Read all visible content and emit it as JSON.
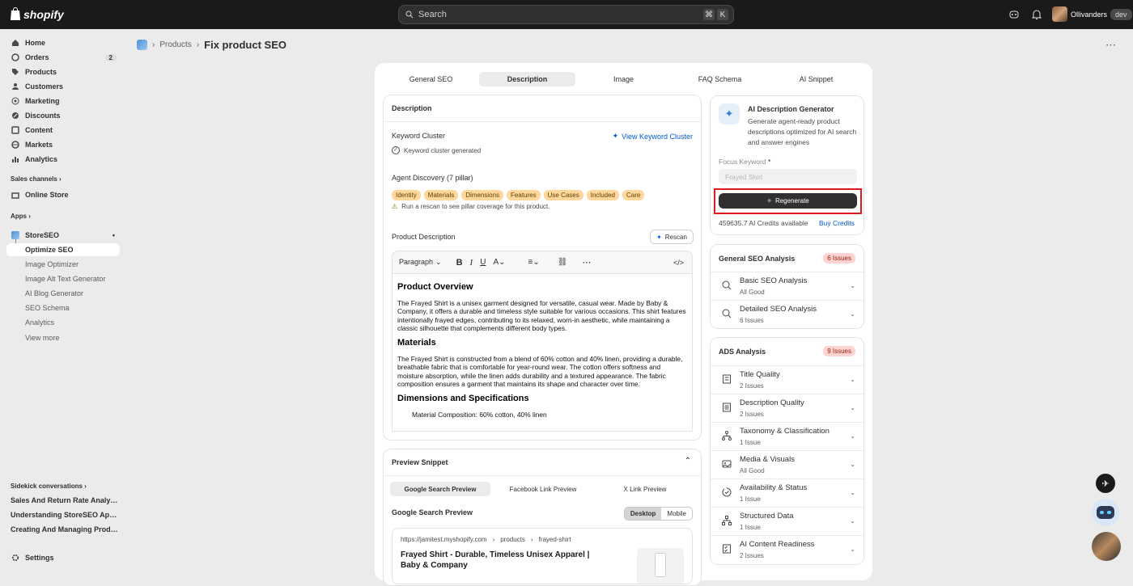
{
  "topbar": {
    "brand": "shopify",
    "search_placeholder": "Search",
    "kbd": [
      "⌘",
      "K"
    ],
    "store_name": "Ollivanders",
    "store_badge": "dev"
  },
  "sidebar": {
    "items": [
      {
        "label": "Home",
        "count": ""
      },
      {
        "label": "Orders",
        "count": "2"
      },
      {
        "label": "Products",
        "count": ""
      },
      {
        "label": "Customers",
        "count": ""
      },
      {
        "label": "Marketing",
        "count": ""
      },
      {
        "label": "Discounts",
        "count": ""
      },
      {
        "label": "Content",
        "count": ""
      },
      {
        "label": "Markets",
        "count": ""
      },
      {
        "label": "Analytics",
        "count": ""
      }
    ],
    "sales_channels": "Sales channels",
    "online_store": "Online Store",
    "apps": "Apps",
    "app_name": "StoreSEO",
    "app_sub": [
      "Optimize SEO",
      "Image Optimizer",
      "Image Alt Text Generator",
      "AI Blog Generator",
      "SEO Schema",
      "Analytics",
      "View more"
    ],
    "sidekick": "Sidekick conversations",
    "conversations": [
      "Sales And Return Rate Analytics",
      "Understanding StoreSEO App Features",
      "Creating And Managing Products"
    ],
    "settings": "Settings"
  },
  "breadcrumb": {
    "parent": "Products",
    "title": "Fix product SEO"
  },
  "tabs": [
    "General SEO",
    "Description",
    "Image",
    "FAQ Schema",
    "AI Snippet"
  ],
  "description": {
    "heading": "Description",
    "keyword_cluster": "Keyword Cluster",
    "view_cluster": "View Keyword Cluster",
    "cluster_status": "Keyword cluster generated",
    "agent_discovery": "Agent Discovery (7 pillar)",
    "pillars": [
      "Identity",
      "Materials",
      "Dimensions",
      "Features",
      "Use Cases",
      "Included",
      "Care"
    ],
    "rescan_hint": "Run a rescan to see pillar coverage for this product.",
    "product_description": "Product Description",
    "rescan": "Rescan",
    "paragraph": "Paragraph",
    "editor": {
      "h1": "Product Overview",
      "p1": "The Frayed Shirt is a unisex garment designed for versatile, casual wear. Made by Baby & Company, it offers a durable and timeless style suitable for various occasions. This shirt features intentionally frayed edges, contributing to its relaxed, worn-in aesthetic, while maintaining a classic silhouette that complements different body types.",
      "h2": "Materials",
      "p2": "The Frayed Shirt is constructed from a blend of 60% cotton and 40% linen, providing a durable, breathable fabric that is comfortable for year-round wear. The cotton offers softness and moisture absorption, while the linen adds durability and a textured appearance. The fabric composition ensures a garment that maintains its shape and character over time.",
      "h3": "Dimensions and Specifications",
      "p3": "Material Composition: 60% cotton, 40% linen"
    }
  },
  "preview": {
    "heading": "Preview Snippet",
    "tabs": [
      "Google Search Preview",
      "Facebook Link Preview",
      "X Link Preview"
    ],
    "google_heading": "Google Search Preview",
    "toggle": [
      "Desktop",
      "Mobile"
    ],
    "url": [
      "https://jamitest.myshopify.com",
      "products",
      "frayed-shirt"
    ],
    "title": "Frayed Shirt - Durable, Timeless Unisex Apparel | Baby & Company"
  },
  "ai": {
    "title": "AI Description Generator",
    "desc": "Generate agent-ready product descriptions optimized for AI search and answer engines",
    "focus_label": "Focus Keyword",
    "required": "*",
    "focus_value": "Frayed Shirt",
    "regenerate": "Regenerate",
    "credits": "459635.7 AI Credits available",
    "buy": "Buy Credits"
  },
  "general_analysis": {
    "heading": "General SEO Analysis",
    "badge": "6 Issues",
    "rows": [
      {
        "title": "Basic SEO Analysis",
        "status": "All Good"
      },
      {
        "title": "Detailed SEO Analysis",
        "status": "6 Issues"
      }
    ]
  },
  "ads_analysis": {
    "heading": "ADS Analysis",
    "badge": "9 Issues",
    "rows": [
      {
        "title": "Title Quality",
        "status": "2 Issues"
      },
      {
        "title": "Description Quality",
        "status": "2 Issues"
      },
      {
        "title": "Taxonomy & Classification",
        "status": "1 Issue"
      },
      {
        "title": "Media & Visuals",
        "status": "All Good"
      },
      {
        "title": "Availability & Status",
        "status": "1 Issue"
      },
      {
        "title": "Structured Data",
        "status": "1 Issue"
      },
      {
        "title": "AI Content Readiness",
        "status": "2 Issues"
      }
    ]
  },
  "colors": {
    "accent": "#303030",
    "highlight": "#e0191c",
    "pill": "#ffd79d",
    "issue": "#fed3d1",
    "link": "#005bd3"
  }
}
